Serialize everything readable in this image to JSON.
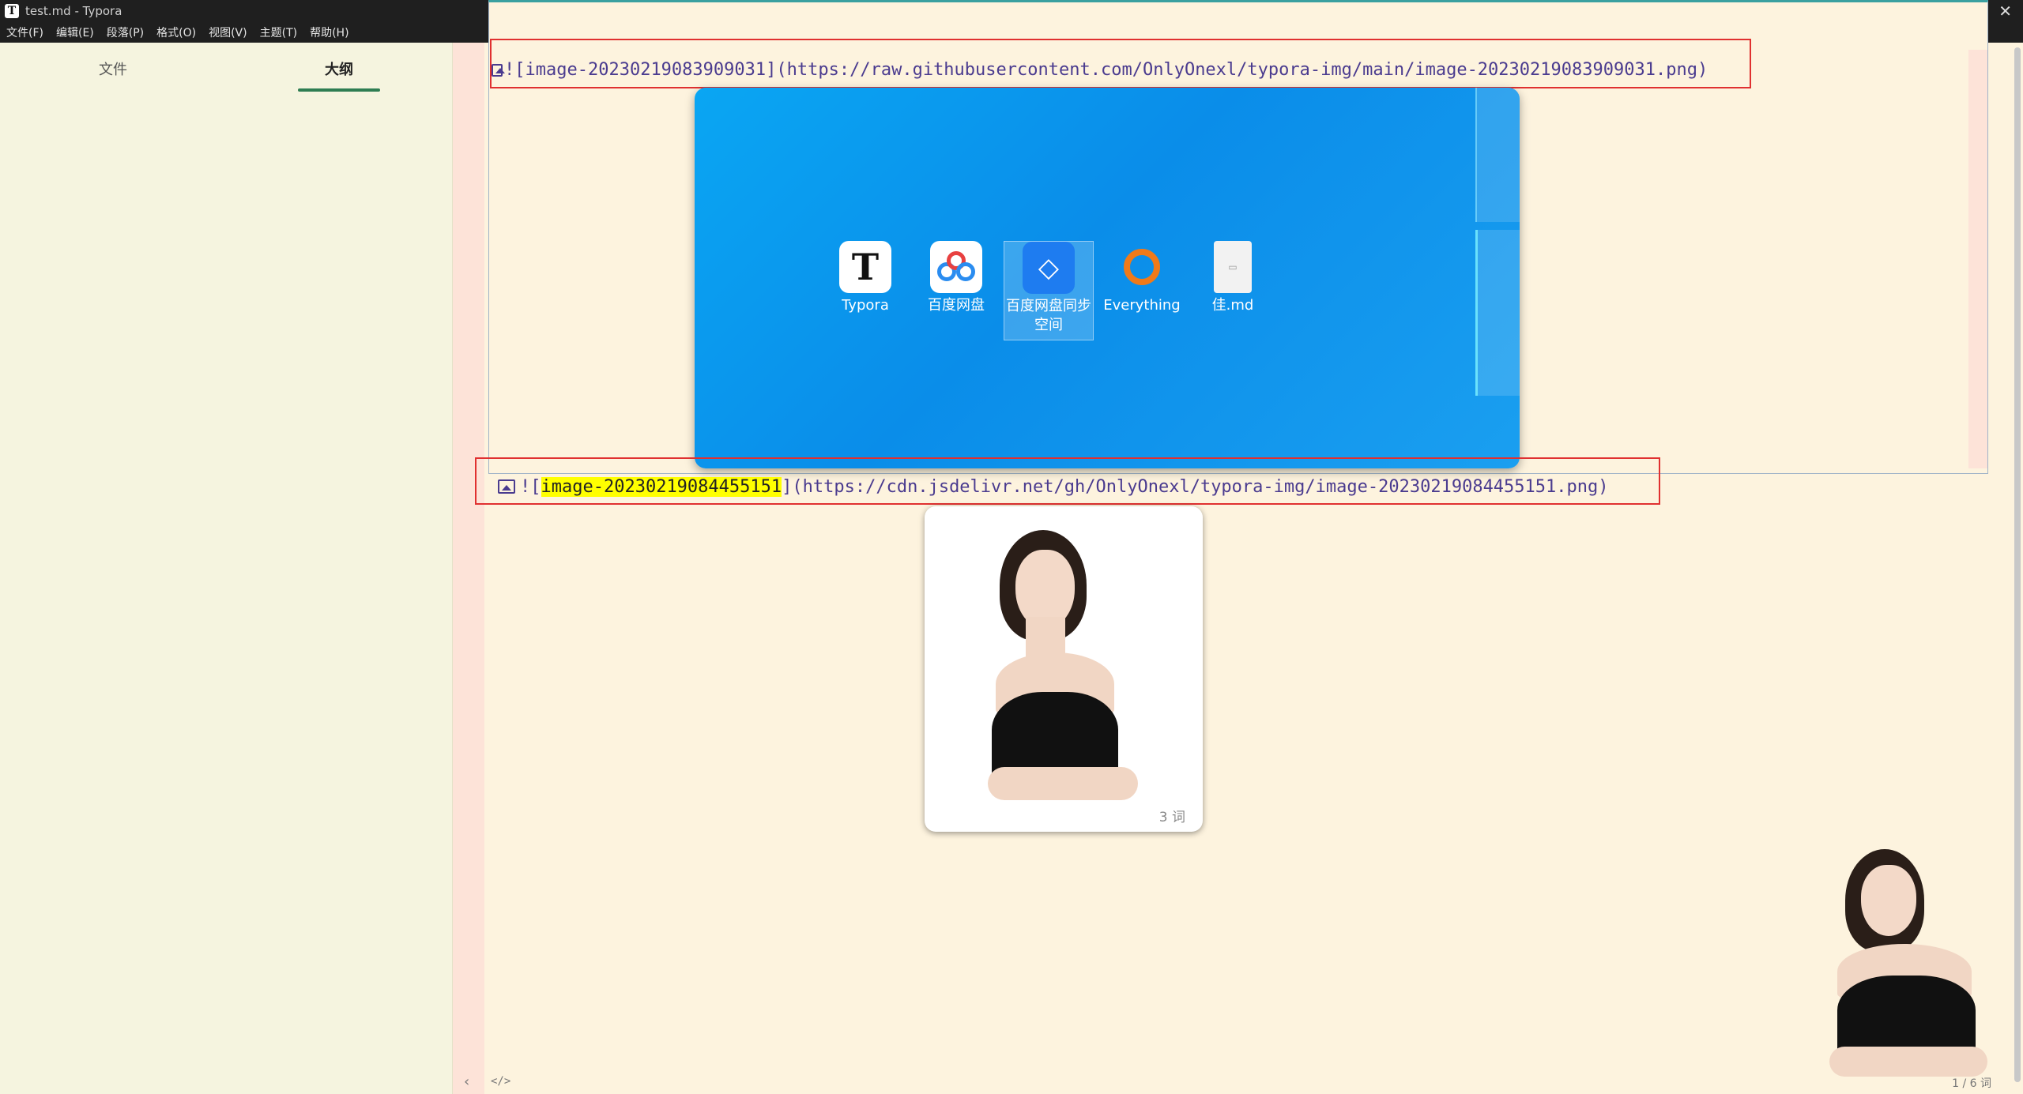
{
  "window": {
    "title": "test.md - Typora",
    "close_glyph": "✕"
  },
  "menu": [
    "文件(F)",
    "编辑(E)",
    "段落(P)",
    "格式(O)",
    "视图(V)",
    "主题(T)",
    "帮助(H)"
  ],
  "sidebar": {
    "tabs": [
      {
        "label": "文件",
        "active": false
      },
      {
        "label": "大纲",
        "active": true
      }
    ]
  },
  "editor": {
    "line1": {
      "prefix": "![",
      "alt": "image-20230219083909031",
      "suffix": "](https://raw.githubusercontent.com/OnlyOnexl/typora-img/main/image-20230219083909031.png)"
    },
    "line2": {
      "prefix": "![",
      "alt": "image-20230219084455151",
      "suffix": "](https://cdn.jsdelivr.net/gh/OnlyOnexl/typora-img/image-20230219084455151.png)"
    },
    "desktop_icons": [
      {
        "label": "Typora",
        "icon": "typora-icon"
      },
      {
        "label": "百度网盘",
        "icon": "baidu-netdisk-icon"
      },
      {
        "label": "百度网盘同步空间",
        "icon": "baidu-sync-icon"
      },
      {
        "label": "Everything",
        "icon": "everything-icon"
      },
      {
        "label": "佳.md",
        "icon": "markdown-file-icon"
      }
    ],
    "card_word_count": "3 词"
  },
  "status": {
    "chevron": "‹",
    "source_toggle": "</>",
    "word_count": "1 / 6 词"
  },
  "colors": {
    "accent": "#2e7d52",
    "highlight": "#ffff00",
    "red_box": "#e03030",
    "code": "#4a3b8f"
  }
}
